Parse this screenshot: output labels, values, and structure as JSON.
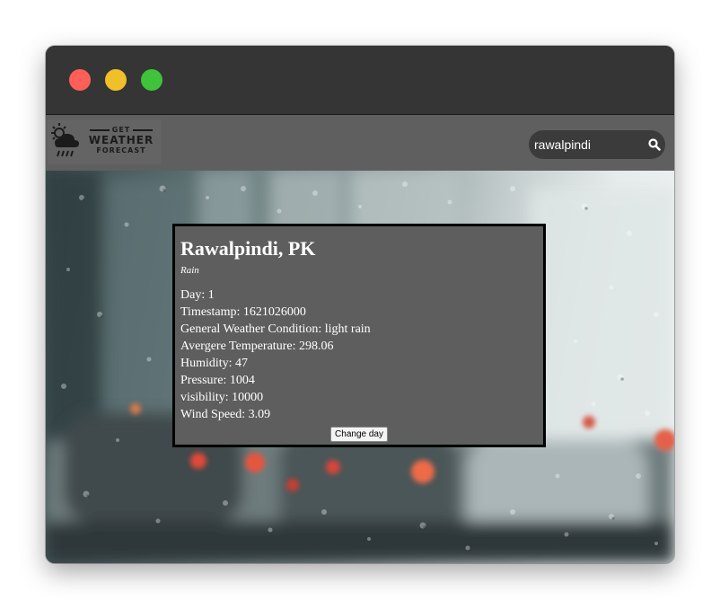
{
  "window": {
    "controls": [
      "close",
      "minimize",
      "maximize"
    ],
    "colors": {
      "close": "#ff5f57",
      "minimize": "#f0bf2a",
      "maximize": "#3ec33a"
    }
  },
  "navbar": {
    "logo": {
      "line1": "GET",
      "line2": "WEATHER",
      "line3": "FORECAST",
      "icon": "sun-cloud-rain-icon"
    },
    "search": {
      "value": "rawalpindi",
      "icon": "search-icon"
    }
  },
  "background": {
    "description_icon": "rainy-window-photo"
  },
  "weather_card": {
    "city": "Rawalpindi, PK",
    "condition": "Rain",
    "stats": [
      "Day: 1",
      "Timestamp: 1621026000",
      "General Weather Condition: light rain",
      "Avergere Temperature: 298.06",
      "Humidity: 47",
      "Pressure: 1004",
      "visibility: 10000",
      "Wind Speed: 3.09"
    ],
    "button_label": "Change day"
  }
}
